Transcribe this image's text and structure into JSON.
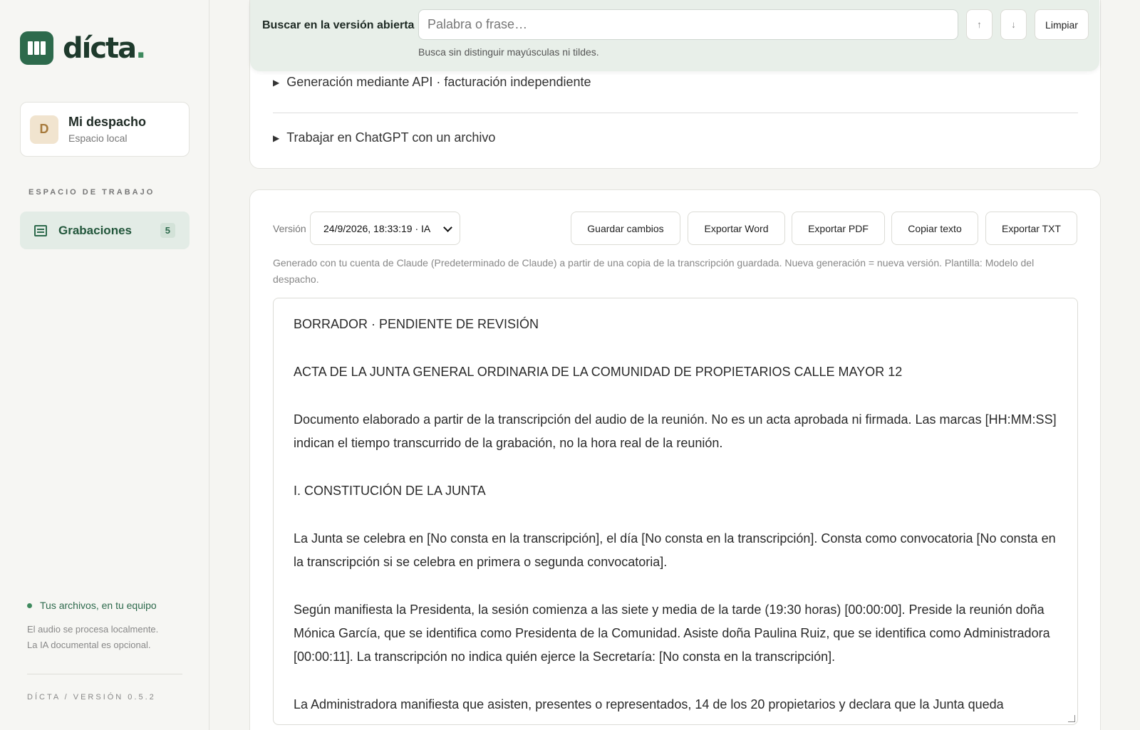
{
  "brand": {
    "name": "dícta",
    "dot": "."
  },
  "account": {
    "initial": "D",
    "name": "Mi despacho",
    "subtitle": "Espacio local"
  },
  "sidebar": {
    "section_label": "ESPACIO DE TRABAJO",
    "items": [
      {
        "label": "Grabaciones",
        "badge": "5",
        "icon": "list-icon",
        "active": true
      }
    ],
    "local_title": "Tus archivos, en tu equipo",
    "local_line1": "El audio se procesa localmente.",
    "local_line2": "La IA documental es opcional.",
    "version": "DÍCTA / VERSIÓN 0.5.2"
  },
  "search": {
    "label": "Buscar en la versión abierta",
    "placeholder": "Palabra o frase…",
    "value": "",
    "up_icon": "↑",
    "down_icon": "↓",
    "clear_label": "Limpiar",
    "hint": "Busca sin distinguir mayúsculas ni tildes."
  },
  "details": [
    "Generación mediante API · facturación independiente",
    "Trabajar en ChatGPT con un archivo"
  ],
  "version_bar": {
    "label": "Versión",
    "selected": "24/9/2026, 18:33:19 · IA",
    "buttons": [
      "Guardar cambios",
      "Exportar Word",
      "Exportar PDF",
      "Copiar texto",
      "Exportar TXT"
    ]
  },
  "generation_note": "Generado con tu cuenta de Claude (Predeterminado de Claude) a partir de una copia de la transcripción guardada. Nueva generación = nueva versión. Plantilla: Modelo del despacho.",
  "document": {
    "paragraphs": [
      "BORRADOR · PENDIENTE DE REVISIÓN",
      "ACTA DE LA JUNTA GENERAL ORDINARIA DE LA COMUNIDAD DE PROPIETARIOS CALLE MAYOR 12",
      "Documento elaborado a partir de la transcripción del audio de la reunión. No es un acta aprobada ni firmada. Las marcas [HH:MM:SS] indican el tiempo transcurrido de la grabación, no la hora real de la reunión.",
      "I. CONSTITUCIÓN DE LA JUNTA",
      "La Junta se celebra en [No consta en la transcripción], el día [No consta en la transcripción]. Consta como convocatoria [No consta en la transcripción si se celebra en primera o segunda convocatoria].",
      "Según manifiesta la Presidenta, la sesión comienza a las siete y media de la tarde (19:30 horas) [00:00:00]. Preside la reunión doña Mónica García, que se identifica como Presidenta de la Comunidad. Asiste doña Paulina Ruiz, que se identifica como Administradora [00:00:11]. La transcripción no indica quién ejerce la Secretaría: [No consta en la transcripción].",
      "La Administradora manifiesta que asisten, presentes o representados, 14 de los 20 propietarios y declara que la Junta queda"
    ]
  },
  "colors": {
    "accent": "#2d6a4c",
    "search_bg": "#e8efe9",
    "nav_active_bg": "#e3ece6"
  }
}
